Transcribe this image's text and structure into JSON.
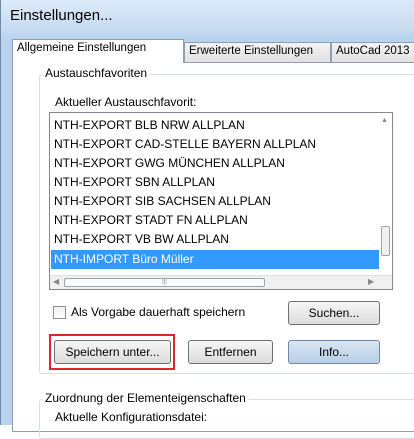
{
  "window": {
    "title": "Einstellungen..."
  },
  "tabs": [
    {
      "label": "Allgemeine Einstellungen",
      "active": true
    },
    {
      "label": "Erweiterte Einstellungen",
      "active": false
    },
    {
      "label": "AutoCad 2013",
      "active": false
    }
  ],
  "exchange_group": {
    "title": "Austauschfavoriten",
    "current_label": "Aktueller Austauschfavorit:",
    "items": [
      "NTH-EXPORT BLB NRW ALLPLAN",
      "NTH-EXPORT CAD-STELLE BAYERN ALLPLAN",
      "NTH-EXPORT GWG MÜNCHEN ALLPLAN",
      "NTH-EXPORT SBN ALLPLAN",
      "NTH-EXPORT SIB SACHSEN ALLPLAN",
      "NTH-EXPORT STADT FN ALLPLAN",
      "NTH-EXPORT VB BW ALLPLAN",
      "NTH-IMPORT Büro Müller"
    ],
    "selected_index": 7,
    "checkbox_label": "Als Vorgabe dauerhaft speichern",
    "checkbox_checked": false,
    "buttons": {
      "search": "Suchen...",
      "save_as": "Speichern unter...",
      "remove": "Entfernen",
      "info": "Info..."
    }
  },
  "mapping_group": {
    "title": "Zuordnung der Elementeigenschaften",
    "config_label": "Aktuelle Konfigurationsdatei:"
  },
  "colors": {
    "selection": "#3399ff",
    "highlight_border": "#e0252a",
    "window_frame": "#b9d3ee"
  }
}
